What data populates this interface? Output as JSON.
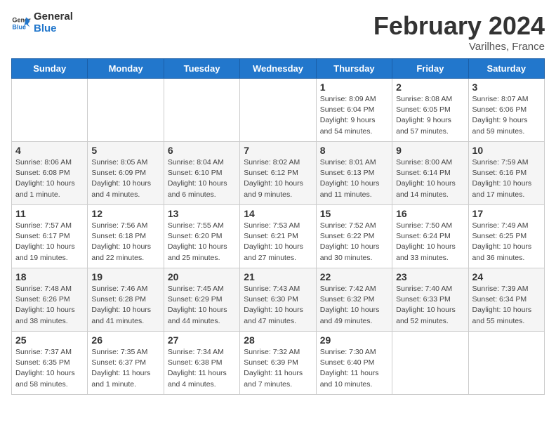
{
  "header": {
    "logo_general": "General",
    "logo_blue": "Blue",
    "month_title": "February 2024",
    "location": "Varilhes, France"
  },
  "weekdays": [
    "Sunday",
    "Monday",
    "Tuesday",
    "Wednesday",
    "Thursday",
    "Friday",
    "Saturday"
  ],
  "weeks": [
    [
      {
        "day": "",
        "info": ""
      },
      {
        "day": "",
        "info": ""
      },
      {
        "day": "",
        "info": ""
      },
      {
        "day": "",
        "info": ""
      },
      {
        "day": "1",
        "info": "Sunrise: 8:09 AM\nSunset: 6:04 PM\nDaylight: 9 hours\nand 54 minutes."
      },
      {
        "day": "2",
        "info": "Sunrise: 8:08 AM\nSunset: 6:05 PM\nDaylight: 9 hours\nand 57 minutes."
      },
      {
        "day": "3",
        "info": "Sunrise: 8:07 AM\nSunset: 6:06 PM\nDaylight: 9 hours\nand 59 minutes."
      }
    ],
    [
      {
        "day": "4",
        "info": "Sunrise: 8:06 AM\nSunset: 6:08 PM\nDaylight: 10 hours\nand 1 minute."
      },
      {
        "day": "5",
        "info": "Sunrise: 8:05 AM\nSunset: 6:09 PM\nDaylight: 10 hours\nand 4 minutes."
      },
      {
        "day": "6",
        "info": "Sunrise: 8:04 AM\nSunset: 6:10 PM\nDaylight: 10 hours\nand 6 minutes."
      },
      {
        "day": "7",
        "info": "Sunrise: 8:02 AM\nSunset: 6:12 PM\nDaylight: 10 hours\nand 9 minutes."
      },
      {
        "day": "8",
        "info": "Sunrise: 8:01 AM\nSunset: 6:13 PM\nDaylight: 10 hours\nand 11 minutes."
      },
      {
        "day": "9",
        "info": "Sunrise: 8:00 AM\nSunset: 6:14 PM\nDaylight: 10 hours\nand 14 minutes."
      },
      {
        "day": "10",
        "info": "Sunrise: 7:59 AM\nSunset: 6:16 PM\nDaylight: 10 hours\nand 17 minutes."
      }
    ],
    [
      {
        "day": "11",
        "info": "Sunrise: 7:57 AM\nSunset: 6:17 PM\nDaylight: 10 hours\nand 19 minutes."
      },
      {
        "day": "12",
        "info": "Sunrise: 7:56 AM\nSunset: 6:18 PM\nDaylight: 10 hours\nand 22 minutes."
      },
      {
        "day": "13",
        "info": "Sunrise: 7:55 AM\nSunset: 6:20 PM\nDaylight: 10 hours\nand 25 minutes."
      },
      {
        "day": "14",
        "info": "Sunrise: 7:53 AM\nSunset: 6:21 PM\nDaylight: 10 hours\nand 27 minutes."
      },
      {
        "day": "15",
        "info": "Sunrise: 7:52 AM\nSunset: 6:22 PM\nDaylight: 10 hours\nand 30 minutes."
      },
      {
        "day": "16",
        "info": "Sunrise: 7:50 AM\nSunset: 6:24 PM\nDaylight: 10 hours\nand 33 minutes."
      },
      {
        "day": "17",
        "info": "Sunrise: 7:49 AM\nSunset: 6:25 PM\nDaylight: 10 hours\nand 36 minutes."
      }
    ],
    [
      {
        "day": "18",
        "info": "Sunrise: 7:48 AM\nSunset: 6:26 PM\nDaylight: 10 hours\nand 38 minutes."
      },
      {
        "day": "19",
        "info": "Sunrise: 7:46 AM\nSunset: 6:28 PM\nDaylight: 10 hours\nand 41 minutes."
      },
      {
        "day": "20",
        "info": "Sunrise: 7:45 AM\nSunset: 6:29 PM\nDaylight: 10 hours\nand 44 minutes."
      },
      {
        "day": "21",
        "info": "Sunrise: 7:43 AM\nSunset: 6:30 PM\nDaylight: 10 hours\nand 47 minutes."
      },
      {
        "day": "22",
        "info": "Sunrise: 7:42 AM\nSunset: 6:32 PM\nDaylight: 10 hours\nand 49 minutes."
      },
      {
        "day": "23",
        "info": "Sunrise: 7:40 AM\nSunset: 6:33 PM\nDaylight: 10 hours\nand 52 minutes."
      },
      {
        "day": "24",
        "info": "Sunrise: 7:39 AM\nSunset: 6:34 PM\nDaylight: 10 hours\nand 55 minutes."
      }
    ],
    [
      {
        "day": "25",
        "info": "Sunrise: 7:37 AM\nSunset: 6:35 PM\nDaylight: 10 hours\nand 58 minutes."
      },
      {
        "day": "26",
        "info": "Sunrise: 7:35 AM\nSunset: 6:37 PM\nDaylight: 11 hours\nand 1 minute."
      },
      {
        "day": "27",
        "info": "Sunrise: 7:34 AM\nSunset: 6:38 PM\nDaylight: 11 hours\nand 4 minutes."
      },
      {
        "day": "28",
        "info": "Sunrise: 7:32 AM\nSunset: 6:39 PM\nDaylight: 11 hours\nand 7 minutes."
      },
      {
        "day": "29",
        "info": "Sunrise: 7:30 AM\nSunset: 6:40 PM\nDaylight: 11 hours\nand 10 minutes."
      },
      {
        "day": "",
        "info": ""
      },
      {
        "day": "",
        "info": ""
      }
    ]
  ]
}
